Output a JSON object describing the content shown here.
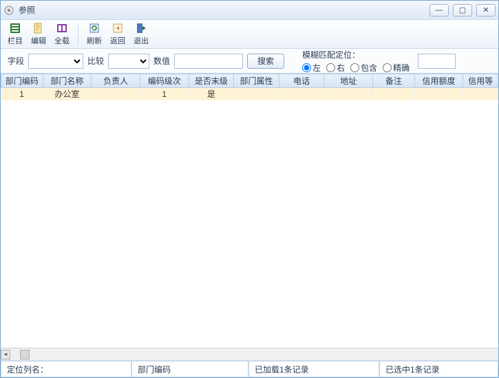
{
  "window": {
    "title": "参照"
  },
  "toolbar": {
    "items": [
      {
        "label": "栏目"
      },
      {
        "label": "编辑"
      },
      {
        "label": "全载"
      },
      {
        "label": "刷新"
      },
      {
        "label": "返回"
      },
      {
        "label": "退出"
      }
    ]
  },
  "filter": {
    "field_label": "字段",
    "compare_label": "比较",
    "value_label": "数值",
    "search_label": "搜索",
    "fuzzy_title": "模糊匹配定位：",
    "opts": {
      "left": "左",
      "right": "右",
      "contain": "包含",
      "exact": "精确"
    }
  },
  "grid": {
    "columns": [
      "部门编码",
      "部门名称",
      "负责人",
      "编码级次",
      "是否末级",
      "部门属性",
      "电话",
      "地址",
      "备注",
      "信用额度",
      "信用等"
    ],
    "rows": [
      {
        "cells": [
          "1",
          "办公室",
          "",
          "1",
          "是",
          "",
          "",
          "",
          "",
          "",
          ""
        ]
      }
    ]
  },
  "status": {
    "c1_label": "定位列名：",
    "c2_value": "部门编码",
    "c3_value": "已加载1条记录",
    "c4_value": "已选中1条记录"
  }
}
